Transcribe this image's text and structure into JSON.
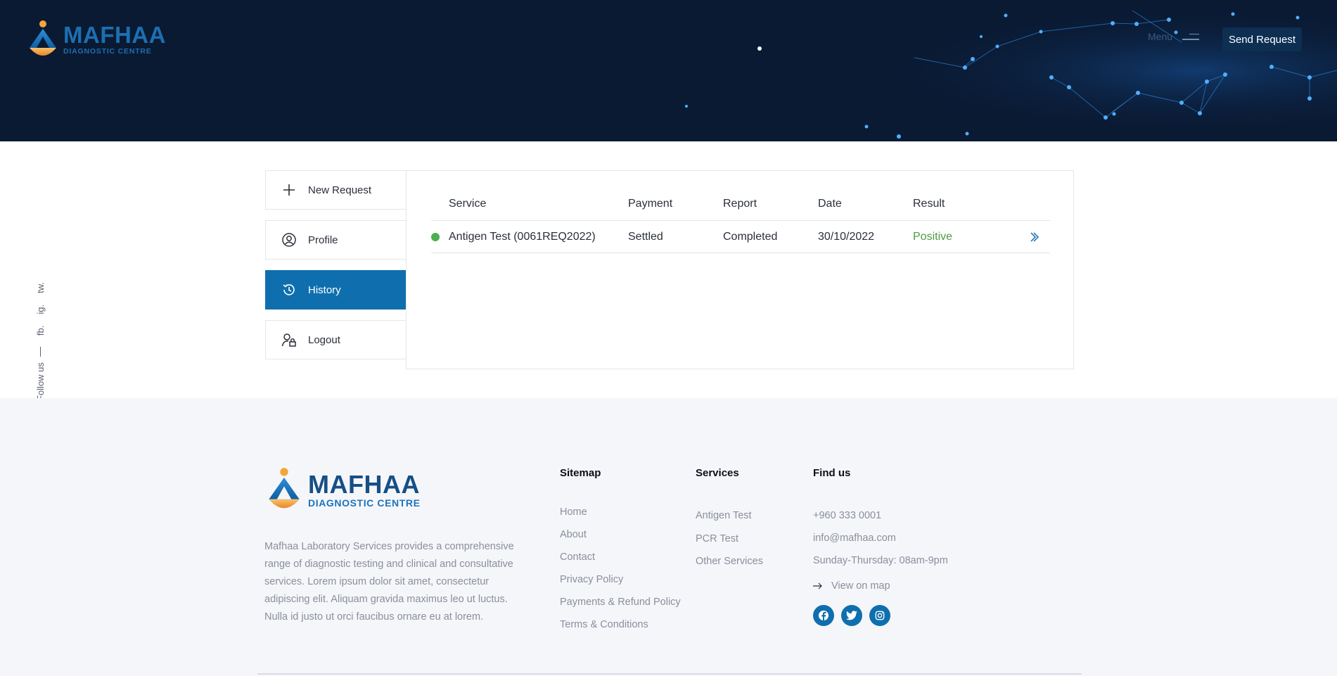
{
  "header": {
    "brand": "MAFHAA",
    "brand_sub": "DIAGNOSTIC CENTRE",
    "menu_label": "Menu",
    "send_request_label": "Send Request"
  },
  "follow": {
    "label": "Follow us",
    "links": [
      "fb.",
      "ig.",
      "tw."
    ]
  },
  "sidebar": {
    "items": [
      {
        "label": "New Request",
        "icon": "plus-icon",
        "active": false
      },
      {
        "label": "Profile",
        "icon": "user-circle-icon",
        "active": false
      },
      {
        "label": "History",
        "icon": "history-icon",
        "active": true
      },
      {
        "label": "Logout",
        "icon": "user-lock-icon",
        "active": false
      }
    ]
  },
  "history_table": {
    "columns": [
      "Service",
      "Payment",
      "Report",
      "Date",
      "Result"
    ],
    "rows": [
      {
        "status_color": "#4caf50",
        "service": "Antigen Test (0061REQ2022)",
        "payment": "Settled",
        "report": "Completed",
        "date": "30/10/2022",
        "result": "Positive",
        "result_color": "#4f9a44",
        "action_icon": "double-chevron-right-icon"
      }
    ]
  },
  "footer": {
    "brand": "MAFHAA",
    "brand_sub": "DIAGNOSTIC CENTRE",
    "about": "Mafhaa Laboratory Services provides a comprehensive range of diagnostic testing and clinical and consultative services. Lorem ipsum dolor sit amet, consectetur adipiscing elit. Aliquam gravida maximus leo ut luctus. Nulla id justo ut orci faucibus ornare eu at lorem.",
    "sitemap": {
      "title": "Sitemap",
      "links": [
        "Home",
        "About",
        "Contact",
        "Privacy Policy",
        "Payments & Refund Policy",
        "Terms & Conditions"
      ]
    },
    "services": {
      "title": "Services",
      "links": [
        "Antigen Test",
        "PCR Test",
        "Other Services"
      ]
    },
    "find_us": {
      "title": "Find us",
      "phone": "+960 333 0001",
      "email": "info@mafhaa.com",
      "hours": "Sunday-Thursday: 08am-9pm",
      "map_label": "View on map",
      "socials": [
        "facebook-icon",
        "twitter-icon",
        "instagram-icon"
      ]
    }
  },
  "colors": {
    "header_bg": "#0a1a33",
    "accent": "#0f6fae",
    "positive": "#4f9a44",
    "footer_bg": "#f5f6fa"
  }
}
